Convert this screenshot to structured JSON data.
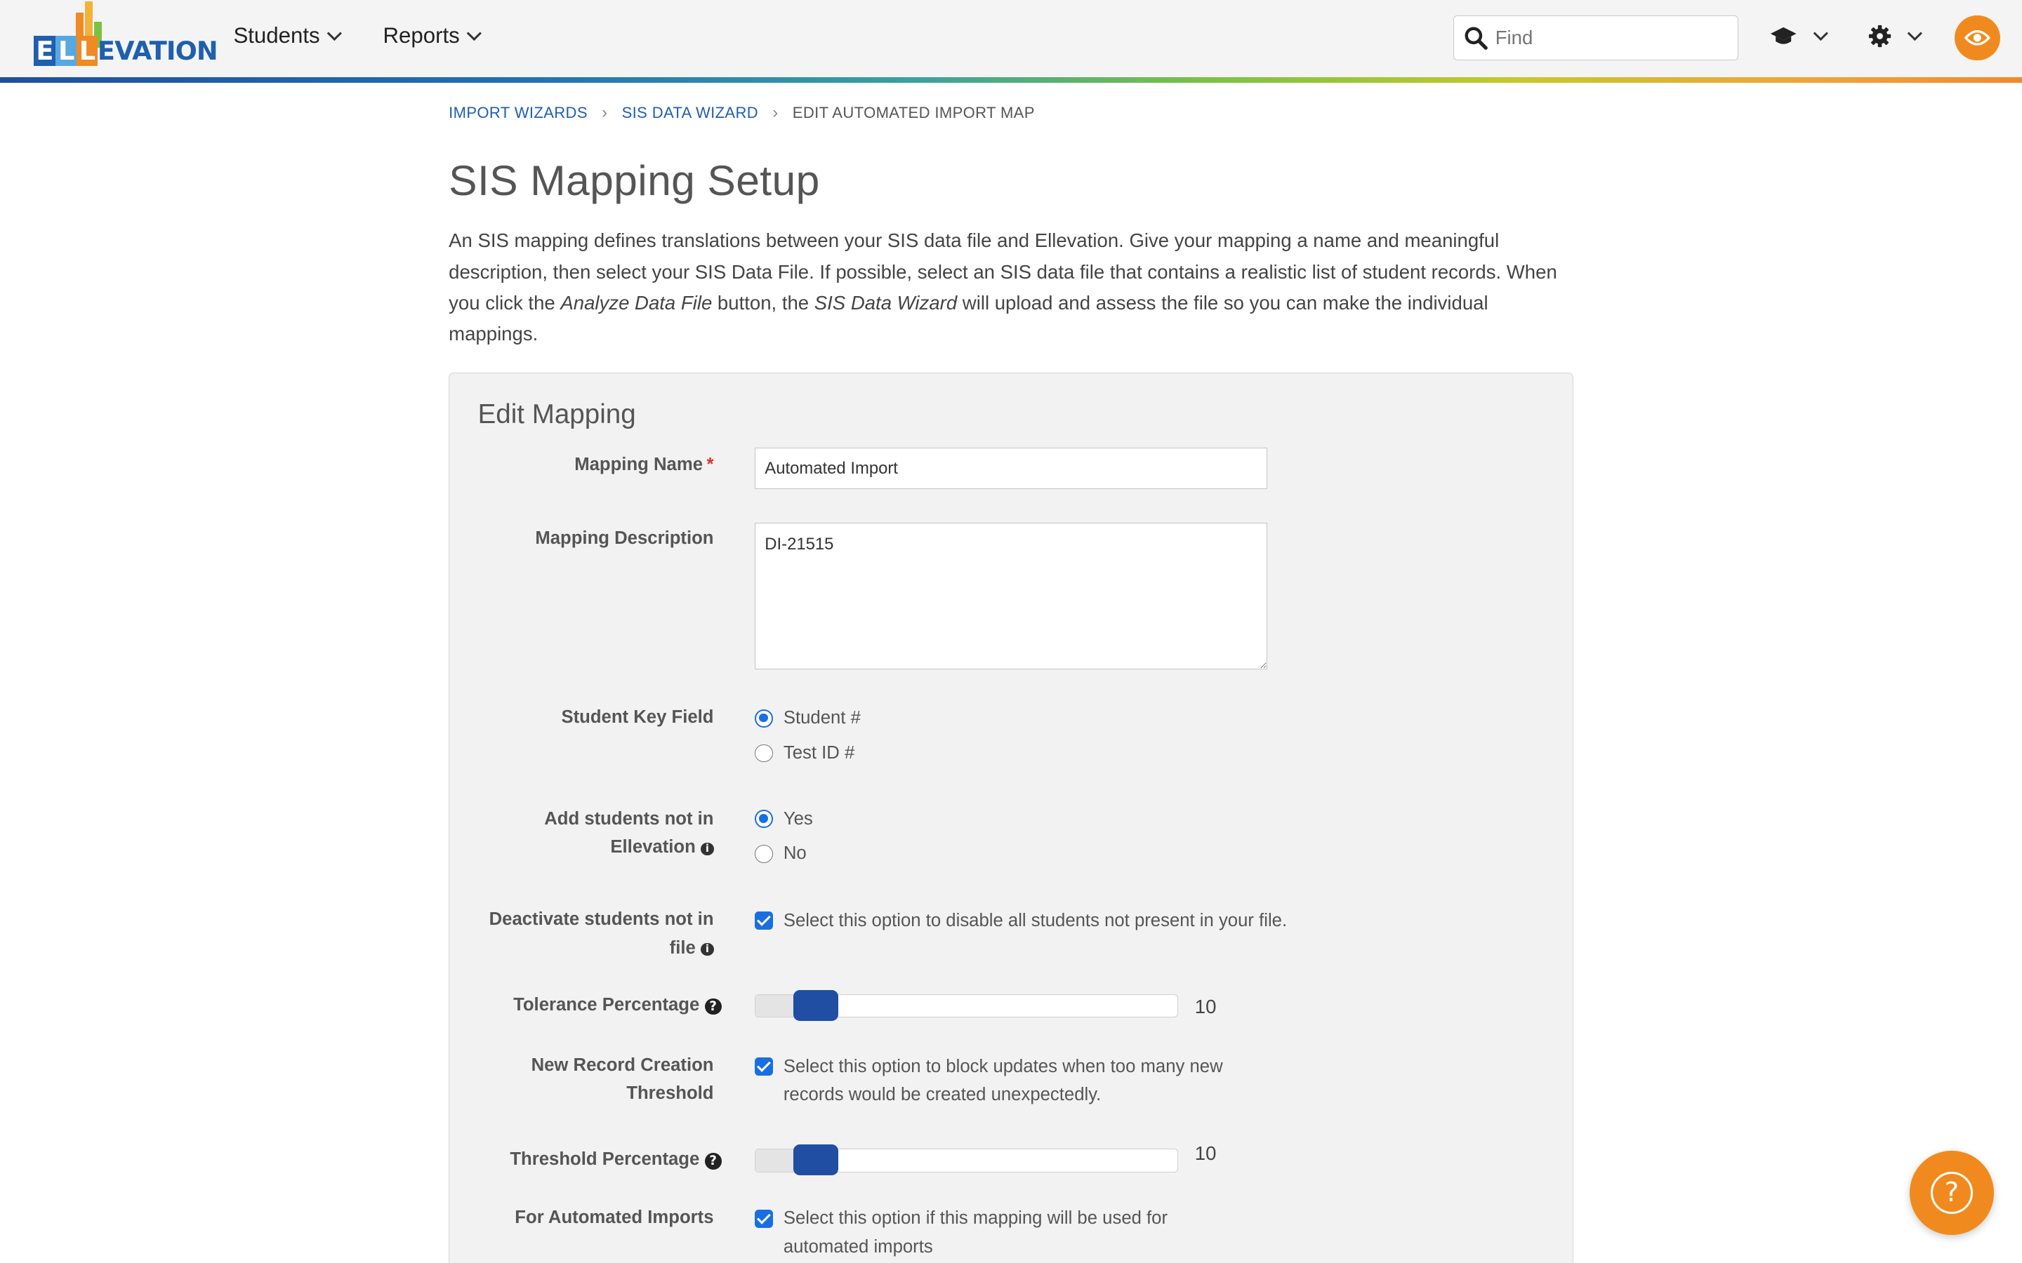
{
  "app": {
    "logo_text": "ELLEVATION",
    "brand_colors": {
      "blue": "#1f5fae",
      "light_blue": "#58a8e0",
      "orange": "#f18a1e",
      "slider": "#1f4ea3",
      "control": "#1a6fe0"
    }
  },
  "nav": {
    "items": [
      {
        "label": "Students",
        "icon": "chevron-down-icon"
      },
      {
        "label": "Reports",
        "icon": "chevron-down-icon"
      }
    ],
    "search": {
      "placeholder": "Find",
      "value": ""
    },
    "icons": [
      "graduation-cap-icon",
      "gear-icon",
      "eye-icon"
    ]
  },
  "breadcrumb": {
    "items": [
      "IMPORT WIZARDS",
      "SIS DATA WIZARD"
    ],
    "current": "EDIT AUTOMATED IMPORT MAP"
  },
  "page": {
    "title": "SIS Mapping Setup",
    "intro": {
      "part1": "An SIS mapping defines translations between your SIS data file and Ellevation. Give your mapping a name and meaningful description, then select your SIS Data File. If possible, select an SIS data file that contains a realistic list of student records. When you click the ",
      "em1": "Analyze Data File",
      "part2": " button, the ",
      "em2": "SIS Data Wizard",
      "part3": " will upload and assess the file so you can make the individual mappings."
    }
  },
  "form": {
    "heading": "Edit Mapping",
    "mapping_name": {
      "label": "Mapping Name",
      "required_mark": "*",
      "value": "Automated Import"
    },
    "mapping_description": {
      "label": "Mapping Description",
      "value": "DI-21515"
    },
    "student_key": {
      "label": "Student Key Field",
      "options": [
        "Student #",
        "Test ID #"
      ],
      "selected": "Student #"
    },
    "add_students": {
      "label_line1": "Add students not in",
      "label_line2": "Ellevation",
      "options": [
        "Yes",
        "No"
      ],
      "selected": "Yes"
    },
    "deactivate": {
      "label_line1": "Deactivate students not in",
      "label_line2": "file",
      "checked": true,
      "text": "Select this option to disable all students not present in your file."
    },
    "tolerance": {
      "label": "Tolerance Percentage",
      "value": "10",
      "level": 0.1
    },
    "new_record": {
      "label_line1": "New Record Creation",
      "label_line2": "Threshold",
      "checked": true,
      "text": "Select this option to block updates when too many new records would be created unexpectedly."
    },
    "threshold": {
      "label": "Threshold Percentage",
      "value": "10",
      "level": 0.1
    },
    "automated": {
      "label": "For Automated Imports",
      "checked": true,
      "text": "Select this option if this mapping will be used for automated imports"
    }
  },
  "help": {
    "label": "?"
  }
}
